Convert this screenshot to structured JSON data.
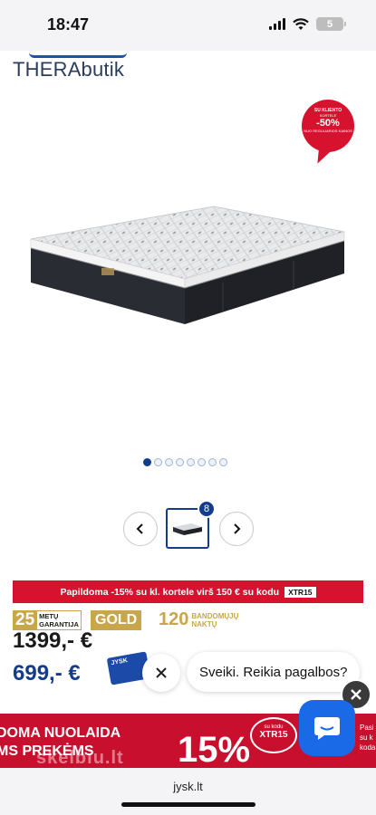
{
  "status_bar": {
    "time": "18:47",
    "battery": "5"
  },
  "brand": {
    "logo_text": "THERAbutik"
  },
  "promo_badge": {
    "line1": "SU KLIENTO",
    "line2": "KORTELE",
    "discount": "-50%",
    "line3": "NUO REGULIARIOS KAINOS"
  },
  "carousel": {
    "slide_count": 8,
    "active_index": 0
  },
  "thumbnails": {
    "count_label": "8"
  },
  "offer_banner": {
    "text": "Papildoma -15% su kl. kortele virš 150 € su kodu",
    "code": "XTR15"
  },
  "badges": {
    "warranty_number": "25",
    "warranty_line1": "METŲ",
    "warranty_line2": "GARANTIJA",
    "tier": "GOLD",
    "trial_number": "120",
    "trial_line1": "BANDOMŲJŲ",
    "trial_line2": "NAKTŲ"
  },
  "prices": {
    "old": "1399,-  €",
    "new": "699,-  €",
    "card_label": "JYSK"
  },
  "chat": {
    "greeting": "Sveiki. Reikia pagalbos?"
  },
  "ad_banner": {
    "left_line1": "DOMA NUOLAIDA",
    "left_line2": "MS PREKĖMS",
    "percent": "15%",
    "code_small": "su kodu",
    "code": "XTR15",
    "right_line1": "Pasi",
    "right_line2": "su k",
    "right_line3": "koda",
    "watermark": "skelbiu.lt"
  },
  "browser": {
    "url": "jysk.lt"
  },
  "colors": {
    "brand_blue": "#143c8c",
    "accent_red": "#d7122f",
    "gold": "#c9a64a",
    "chat_blue": "#1a6ae8"
  }
}
